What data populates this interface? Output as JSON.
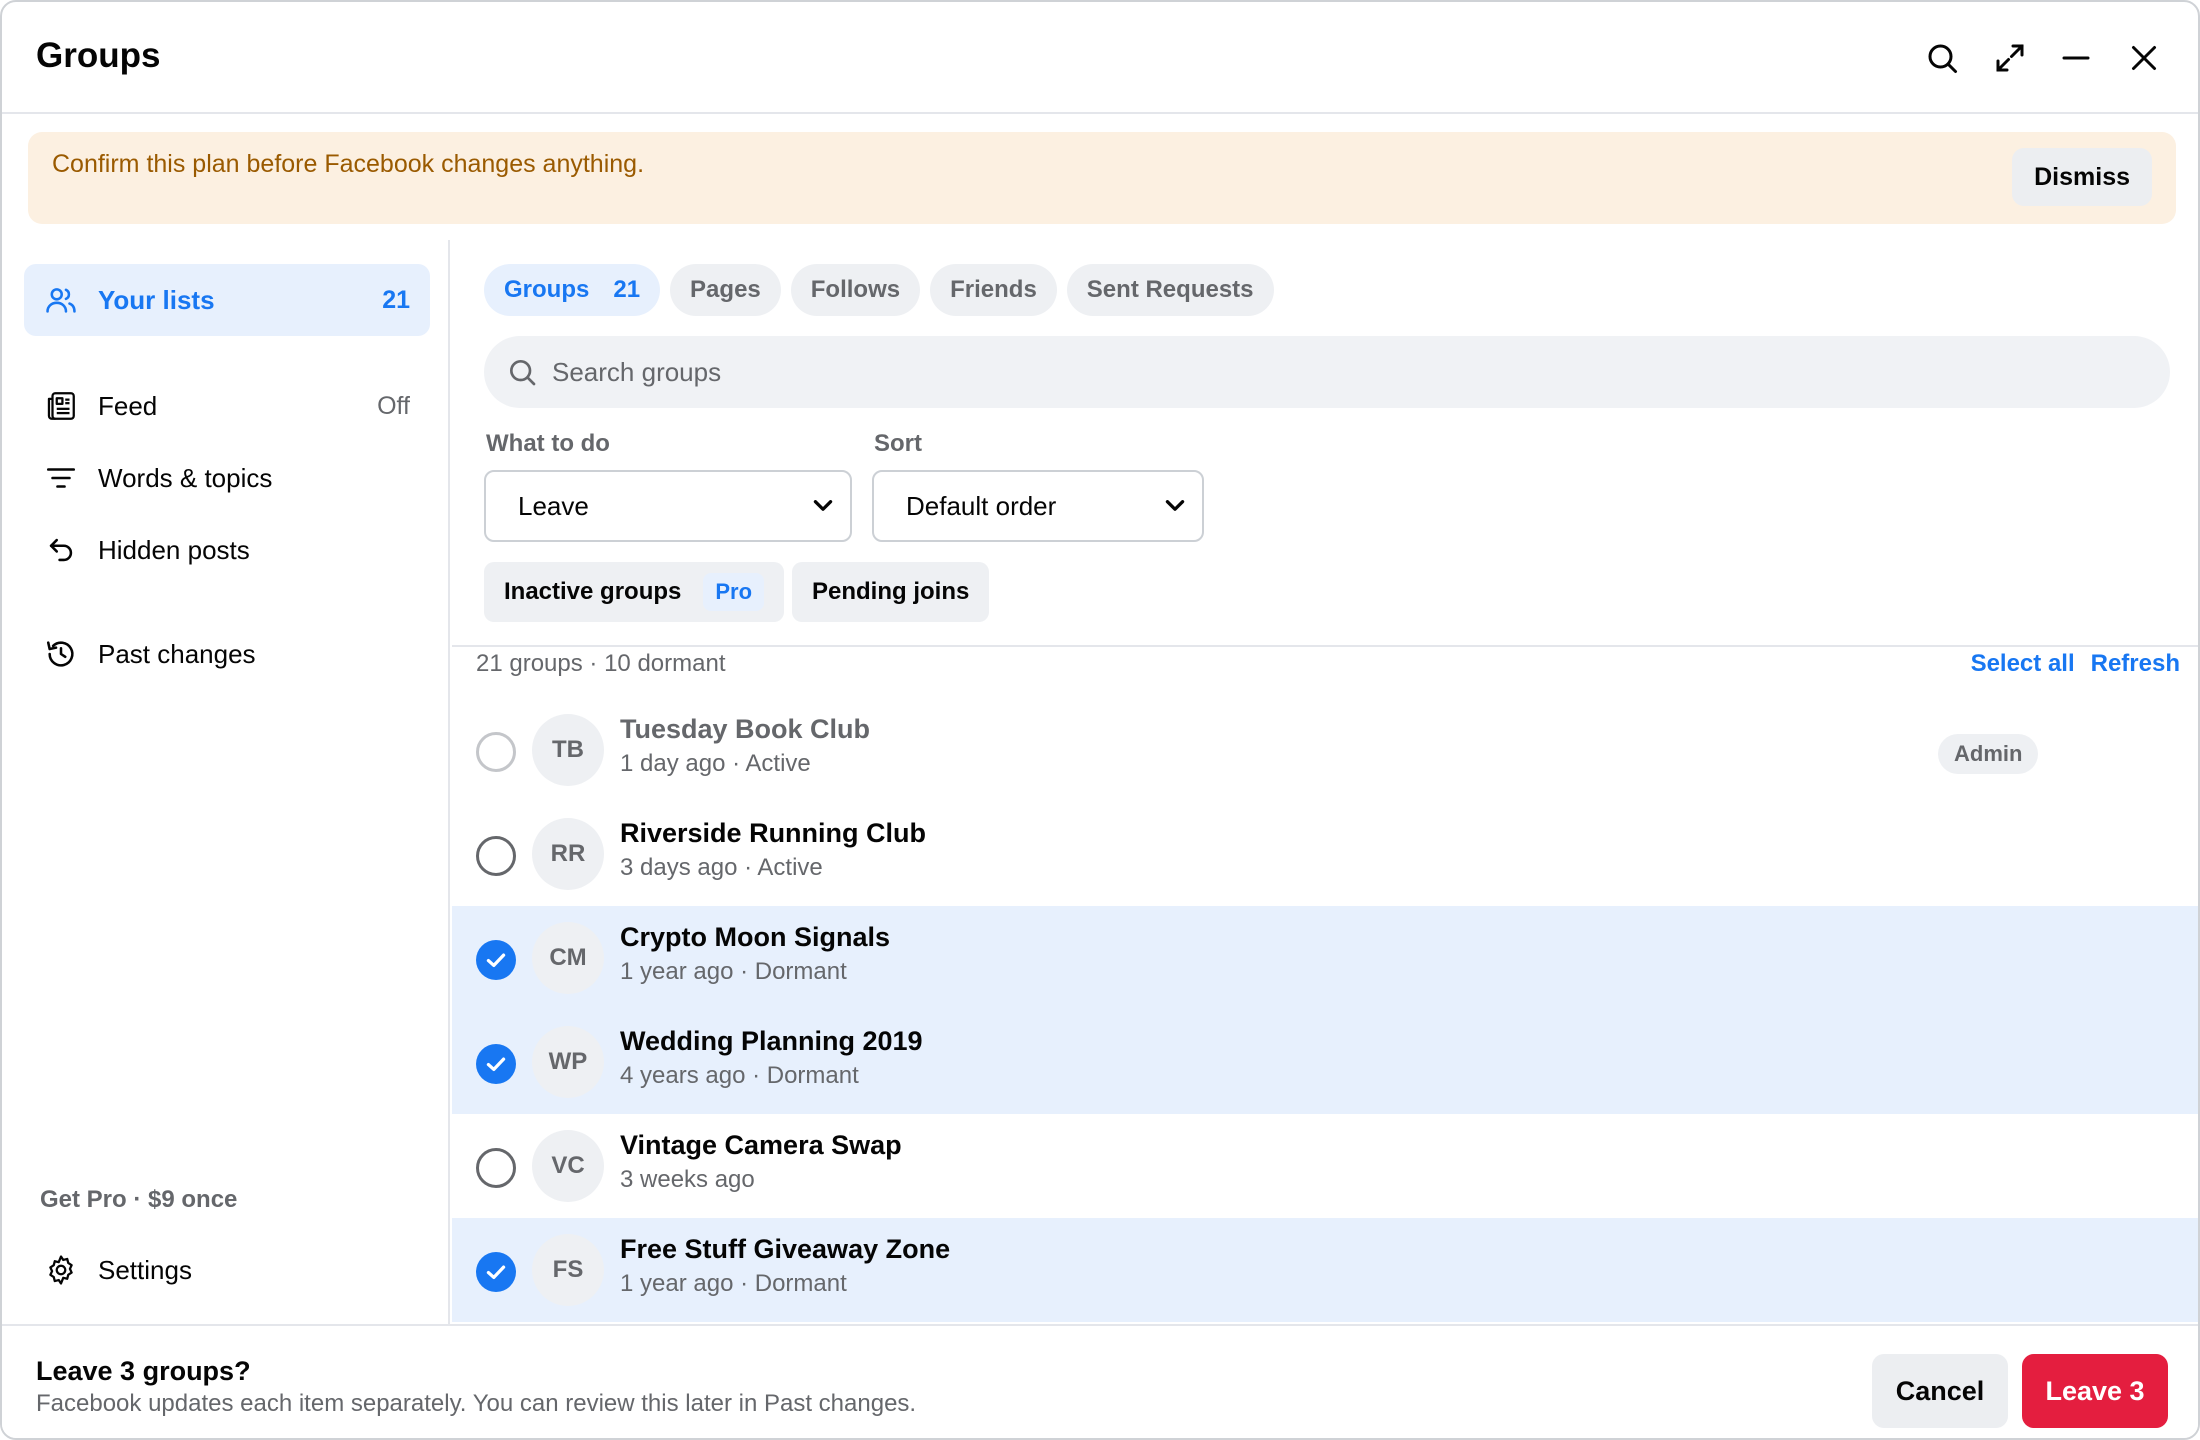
{
  "window": {
    "title": "Groups"
  },
  "banner": {
    "message": "Confirm this plan before Facebook changes anything.",
    "dismiss_label": "Dismiss"
  },
  "sidebar": {
    "items": [
      {
        "label": "Your lists",
        "count": "21",
        "icon": "people-icon",
        "active": true
      },
      {
        "label": "Feed",
        "count": "Off",
        "icon": "feed-icon"
      },
      {
        "label": "Words & topics",
        "icon": "filter-icon"
      },
      {
        "label": "Hidden posts",
        "icon": "undo-icon"
      },
      {
        "label": "Past changes",
        "icon": "history-icon"
      }
    ],
    "get_pro": "Get Pro · $9 once",
    "settings_label": "Settings"
  },
  "tabs": [
    {
      "label": "Groups",
      "count": "21",
      "active": true
    },
    {
      "label": "Pages"
    },
    {
      "label": "Follows"
    },
    {
      "label": "Friends"
    },
    {
      "label": "Sent Requests"
    }
  ],
  "search": {
    "placeholder": "Search groups",
    "value": ""
  },
  "filters": {
    "action_label": "What to do",
    "action_value": "Leave",
    "sort_label": "Sort",
    "sort_value": "Default order",
    "chips": [
      {
        "label": "Inactive groups",
        "badge": "Pro"
      },
      {
        "label": "Pending joins"
      }
    ]
  },
  "list": {
    "summary": "21 groups · 10 dormant",
    "select_all": "Select all",
    "refresh": "Refresh",
    "rows": [
      {
        "initials": "TB",
        "name": "Tuesday Book Club",
        "meta": "1 day ago · Active",
        "selected": false,
        "badge": "Admin",
        "disabled": true
      },
      {
        "initials": "RR",
        "name": "Riverside Running Club",
        "meta": "3 days ago · Active",
        "selected": false
      },
      {
        "initials": "CM",
        "name": "Crypto Moon Signals",
        "meta": "1 year ago · Dormant",
        "selected": true
      },
      {
        "initials": "WP",
        "name": "Wedding Planning 2019",
        "meta": "4 years ago · Dormant",
        "selected": true
      },
      {
        "initials": "VC",
        "name": "Vintage Camera Swap",
        "meta": "3 weeks ago",
        "selected": false
      },
      {
        "initials": "FS",
        "name": "Free Stuff Giveaway Zone",
        "meta": "1 year ago · Dormant",
        "selected": true
      }
    ]
  },
  "footer": {
    "title": "Leave 3 groups?",
    "subtitle": "Facebook updates each item separately. You can review this later in Past changes.",
    "cancel_label": "Cancel",
    "confirm_label": "Leave 3"
  },
  "colors": {
    "accent": "#1877f2",
    "danger": "#e41e3f",
    "banner_bg": "#fcf0e1",
    "banner_text": "#9a5a00",
    "selected_row": "#e7f0fd"
  }
}
